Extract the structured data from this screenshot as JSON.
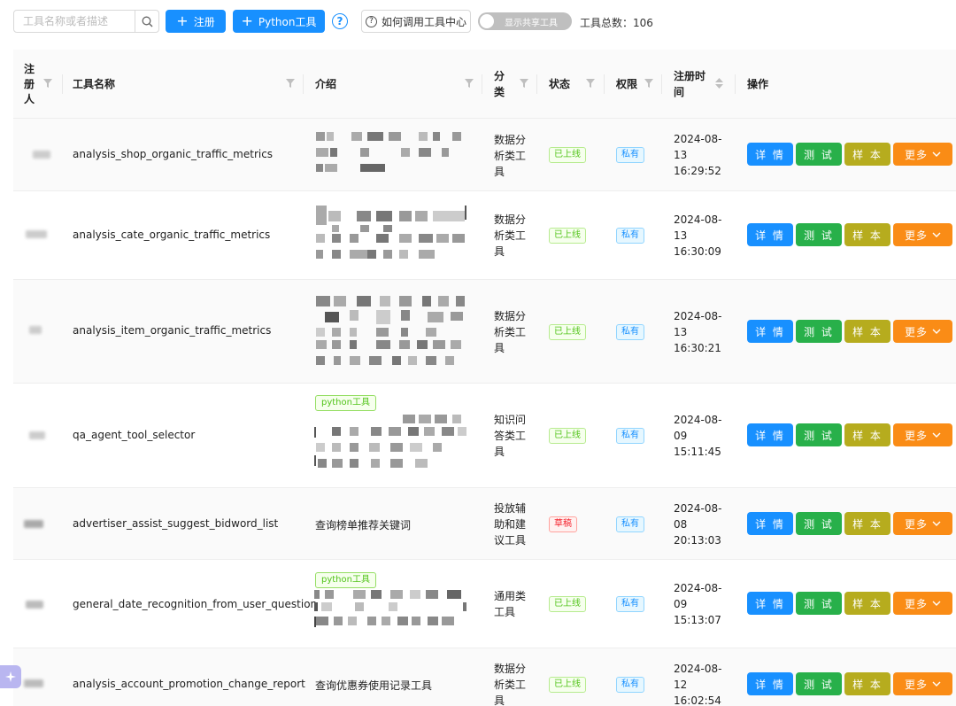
{
  "toolbar": {
    "search_placeholder": "工具名称或者描述",
    "register_label": "注册",
    "python_tool_label": "Python工具",
    "how_to_label": "如何调用工具中心",
    "toggle_label": "显示共享工具",
    "total_label": "工具总数：106"
  },
  "columns": {
    "registrant": "注册人",
    "name": "工具名称",
    "intro": "介绍",
    "category": "分类",
    "status": "状态",
    "permission": "权限",
    "time": "注册时间",
    "actions": "操作"
  },
  "actions": {
    "detail": "详 情",
    "test": "测 试",
    "sample": "样 本",
    "more": "更多"
  },
  "rows": [
    {
      "name": "analysis_shop_organic_traffic_metrics",
      "intro": "",
      "python_tag": "",
      "category": [
        "数据分",
        "析类工",
        "具"
      ],
      "status": "已上线",
      "permission": "私有",
      "date": "2024-08-",
      "day": "13",
      "clock": "16:29:52"
    },
    {
      "name": "analysis_cate_organic_traffic_metrics",
      "intro": "",
      "python_tag": "",
      "category": [
        "数据分",
        "析类工",
        "具"
      ],
      "status": "已上线",
      "permission": "私有",
      "date": "2024-08-",
      "day": "13",
      "clock": "16:30:09"
    },
    {
      "name": "analysis_item_organic_traffic_metrics",
      "intro": "",
      "python_tag": "",
      "category": [
        "数据分",
        "析类工",
        "具"
      ],
      "status": "已上线",
      "permission": "私有",
      "date": "2024-08-",
      "day": "13",
      "clock": "16:30:21"
    },
    {
      "name": "qa_agent_tool_selector",
      "intro": "",
      "python_tag": "python工具",
      "category": [
        "知识问",
        "答类工",
        "具"
      ],
      "status": "已上线",
      "permission": "私有",
      "date": "2024-08-",
      "day": "09",
      "clock": "15:11:45"
    },
    {
      "name": "advertiser_assist_suggest_bidword_list",
      "intro": "查询榜单推荐关键词",
      "python_tag": "",
      "category": [
        "投放辅",
        "助和建",
        "议工具"
      ],
      "status": "草稿",
      "permission": "私有",
      "date": "2024-08-",
      "day": "08",
      "clock": "20:13:03"
    },
    {
      "name": "general_date_recognition_from_user_question",
      "intro": "",
      "python_tag": "python工具",
      "category": [
        "通用类",
        "工具"
      ],
      "status": "已上线",
      "permission": "私有",
      "date": "2024-08-",
      "day": "09",
      "clock": "15:13:07"
    },
    {
      "name": "analysis_account_promotion_change_report",
      "intro": "查询优惠券使用记录工具",
      "python_tag": "",
      "category": [
        "数据分",
        "析类工",
        "具"
      ],
      "status": "已上线",
      "permission": "私有",
      "date": "2024-08-",
      "day": "12",
      "clock": "16:02:54"
    }
  ],
  "colors": {
    "primary": "#1890ff",
    "test": "#28b04a",
    "sample": "#b6ac1e",
    "more": "#fa8c16",
    "online": "#52c41a",
    "draft": "#f5222d"
  }
}
